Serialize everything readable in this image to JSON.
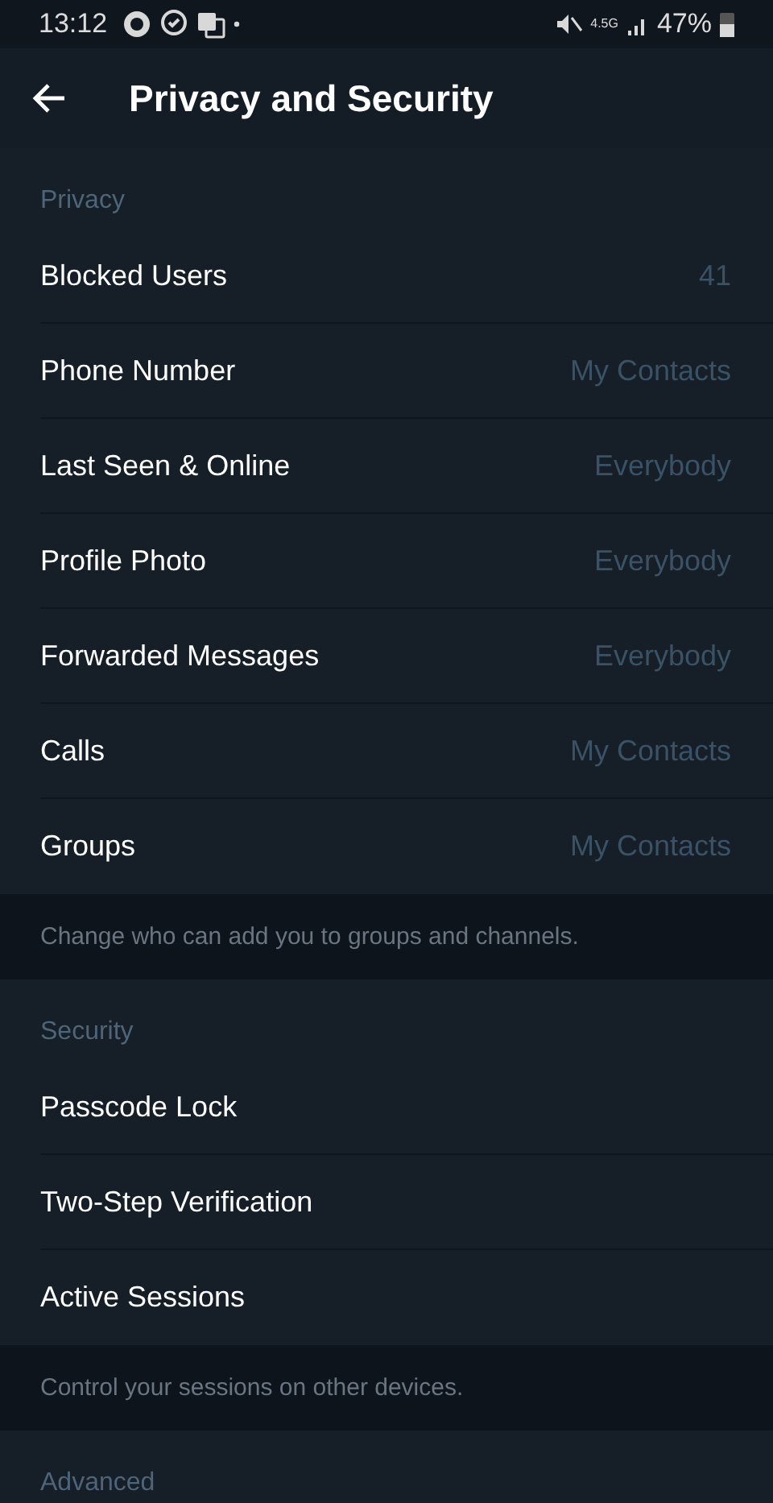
{
  "status_bar": {
    "time": "13:12",
    "network": "4.5G",
    "battery": "47%"
  },
  "header": {
    "title": "Privacy and Security"
  },
  "sections": [
    {
      "title": "Privacy",
      "rows": [
        {
          "label": "Blocked Users",
          "value": "41"
        },
        {
          "label": "Phone Number",
          "value": "My Contacts"
        },
        {
          "label": "Last Seen & Online",
          "value": "Everybody"
        },
        {
          "label": "Profile Photo",
          "value": "Everybody"
        },
        {
          "label": "Forwarded Messages",
          "value": "Everybody"
        },
        {
          "label": "Calls",
          "value": "My Contacts"
        },
        {
          "label": "Groups",
          "value": "My Contacts"
        }
      ],
      "footer": "Change who can add you to groups and channels."
    },
    {
      "title": "Security",
      "rows": [
        {
          "label": "Passcode Lock"
        },
        {
          "label": "Two-Step Verification"
        },
        {
          "label": "Active Sessions"
        }
      ],
      "footer": "Control your sessions on other devices."
    },
    {
      "title": "Advanced"
    }
  ]
}
